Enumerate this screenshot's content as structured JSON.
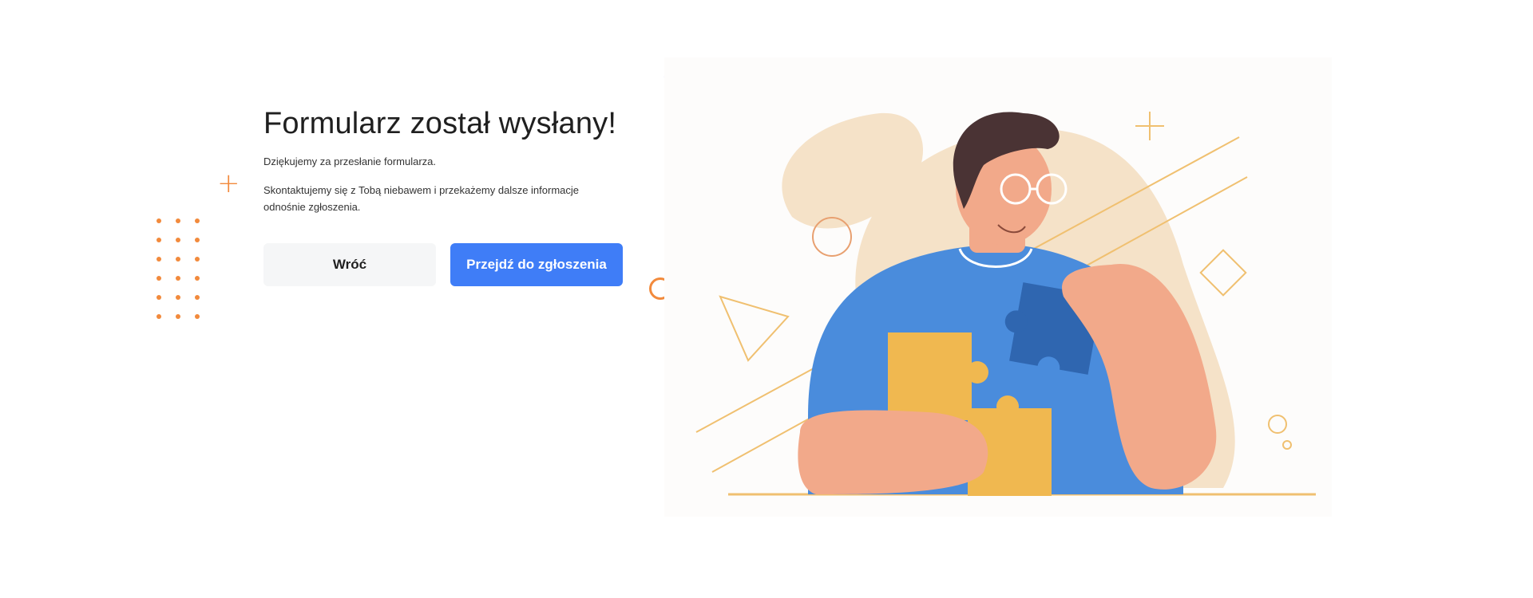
{
  "confirmation": {
    "title": "Formularz został wysłany!",
    "thanks": "Dziękujemy za przesłanie formularza.",
    "info": "Skontaktujemy się z Tobą niebawem i przekażemy dalsze informacje odnośnie zgłoszenia."
  },
  "actions": {
    "back_label": "Wróć",
    "go_label": "Przejdź do zgłoszenia"
  },
  "colors": {
    "primary": "#3f7df7",
    "accent_orange": "#f28a3c",
    "accent_purple": "#4b2bd6",
    "blob": "#f5e2c8",
    "shirt": "#4a8cdc",
    "puzzle_yellow": "#f0b850",
    "puzzle_blue": "#2f66b0"
  },
  "icons": {
    "decoration": [
      "plus-icon",
      "dots-pattern",
      "ring-icon"
    ]
  }
}
